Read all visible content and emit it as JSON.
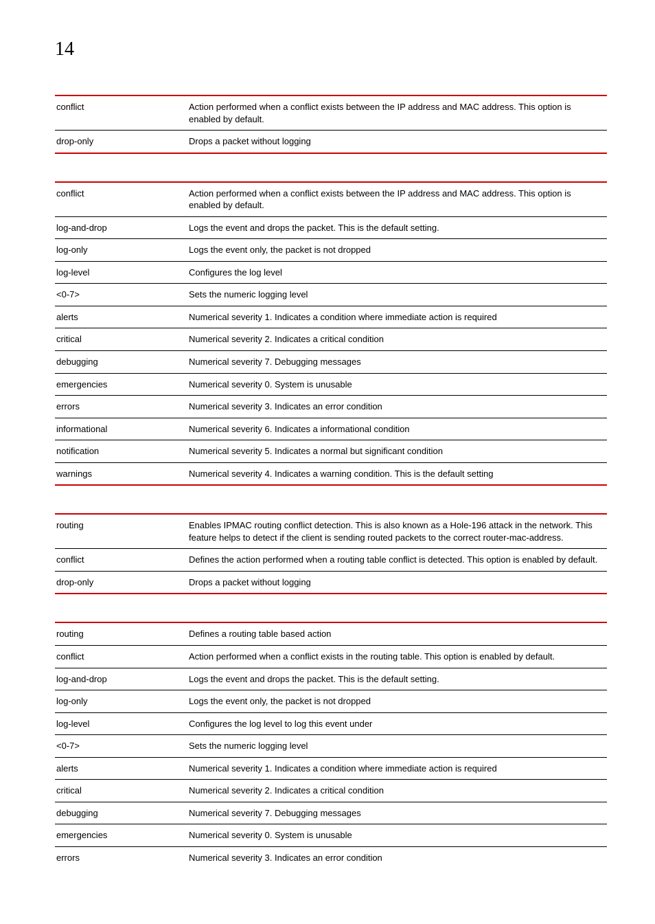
{
  "page_number": "14",
  "tables": [
    {
      "rows": [
        {
          "term": "conflict",
          "desc": "Action performed when a conflict exists between the IP address and MAC address. This option is enabled by default."
        },
        {
          "term": "drop-only",
          "desc": "Drops a packet without logging"
        }
      ]
    },
    {
      "rows": [
        {
          "term": "conflict",
          "desc": "Action performed when a conflict exists between the IP address and MAC address. This option is enabled by default."
        },
        {
          "term": "log-and-drop",
          "desc": "Logs the event and drops the packet. This is the default setting."
        },
        {
          "term": "log-only",
          "desc": "Logs the event only, the packet is not dropped"
        },
        {
          "term": "log-level",
          "desc": "Configures the log level"
        },
        {
          "term": "<0-7>",
          "desc": "Sets the numeric logging level"
        },
        {
          "term": "alerts",
          "desc": "Numerical severity 1. Indicates a condition where immediate action is required"
        },
        {
          "term": "critical",
          "desc": "Numerical severity 2. Indicates a critical condition"
        },
        {
          "term": "debugging",
          "desc": "Numerical severity 7. Debugging messages"
        },
        {
          "term": "emergencies",
          "desc": "Numerical severity 0. System is unusable"
        },
        {
          "term": "errors",
          "desc": "Numerical severity 3. Indicates an error condition"
        },
        {
          "term": "informational",
          "desc": "Numerical severity 6. Indicates a informational condition"
        },
        {
          "term": "notification",
          "desc": "Numerical severity 5. Indicates a normal but significant condition"
        },
        {
          "term": "warnings",
          "desc": "Numerical severity 4. Indicates a warning condition. This is the default setting"
        }
      ]
    },
    {
      "rows": [
        {
          "term": "routing",
          "desc": "Enables IPMAC routing conflict detection. This is also known as a Hole-196 attack in the network. This feature helps to detect if the client is sending routed packets to the correct router-mac-address."
        },
        {
          "term": "conflict",
          "desc": "Defines the action performed when a routing table conflict is detected. This option is enabled by default."
        },
        {
          "term": "drop-only",
          "desc": "Drops a packet without logging"
        }
      ]
    },
    {
      "rows": [
        {
          "term": "routing",
          "desc": "Defines a routing table based action"
        },
        {
          "term": "conflict",
          "desc": "Action performed when a conflict exists in the routing table. This option is enabled by default."
        },
        {
          "term": "log-and-drop",
          "desc": "Logs the event and drops the packet. This is the default setting."
        },
        {
          "term": "log-only",
          "desc": "Logs the event only, the packet is not dropped"
        },
        {
          "term": "log-level",
          "desc": "Configures the log level to log this event under"
        },
        {
          "term": "<0-7>",
          "desc": "Sets the numeric logging level"
        },
        {
          "term": "alerts",
          "desc": "Numerical severity 1. Indicates a condition where immediate action is required"
        },
        {
          "term": "critical",
          "desc": "Numerical severity 2. Indicates a critical condition"
        },
        {
          "term": "debugging",
          "desc": "Numerical severity 7. Debugging messages"
        },
        {
          "term": "emergencies",
          "desc": "Numerical severity 0. System is unusable"
        },
        {
          "term": "errors",
          "desc": "Numerical severity 3. Indicates an error condition"
        }
      ]
    }
  ]
}
